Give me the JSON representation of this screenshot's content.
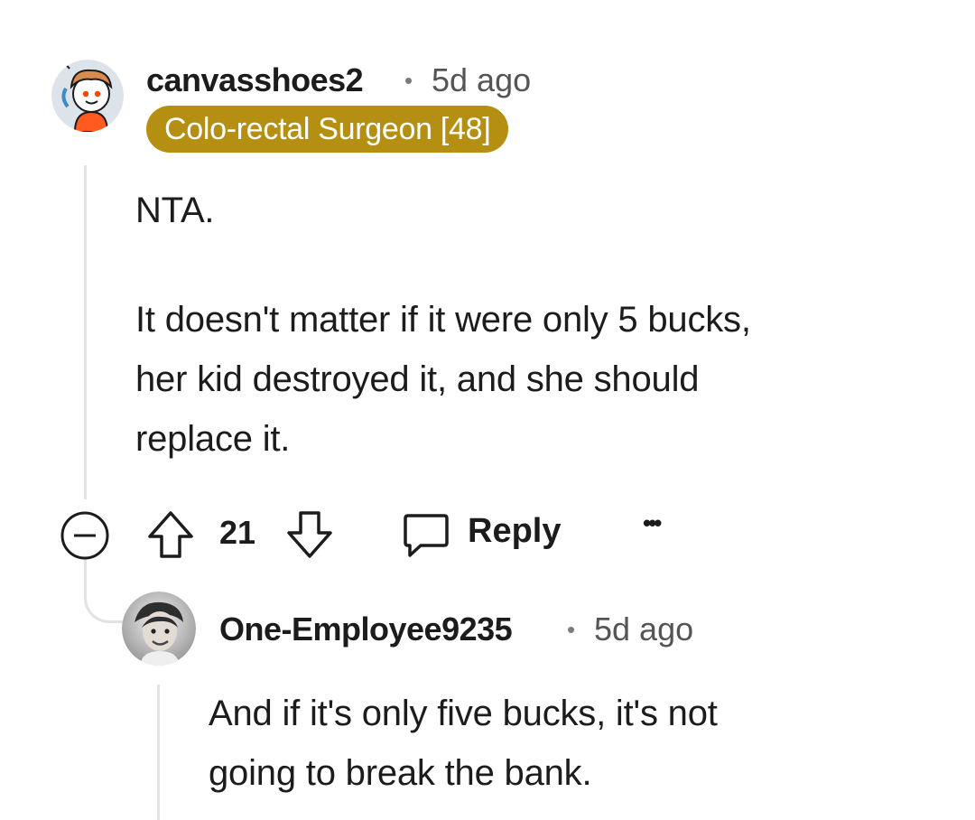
{
  "comments": [
    {
      "username": "canvasshoes2",
      "separator": "•",
      "age": "5d ago",
      "flair": "Colo-rectal Surgeon [48]",
      "avatar_icon": "snoo-avatar-icon",
      "body": [
        "NTA.",
        "It doesn't matter if it were only 5 bucks,",
        "her kid destroyed it, and she should",
        "replace it."
      ],
      "votes": "21",
      "reply_label": "Reply",
      "more_label": "•••"
    },
    {
      "username": "One-Employee9235",
      "separator": "•",
      "age": "5d ago",
      "avatar_icon": "photo-avatar-icon",
      "body": [
        "And if it's only five bucks, it's not",
        "going to break the bank."
      ]
    }
  ],
  "colors": {
    "flair_bg": "#b48f12",
    "thread_line": "#e2e2e2"
  }
}
